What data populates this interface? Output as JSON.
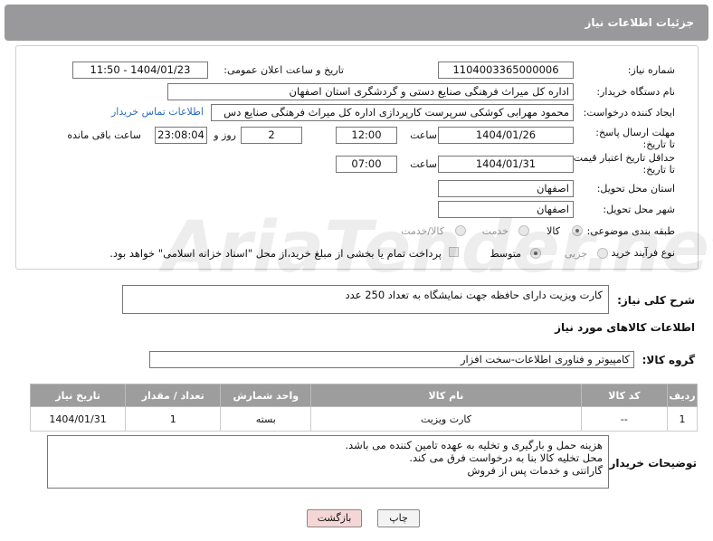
{
  "header": {
    "title": "جزئیات اطلاعات نیاز"
  },
  "fields": {
    "need_number_label": "شماره نیاز:",
    "need_number": "1104003365000006",
    "announce_label": "تاریخ و ساعت اعلان عمومی:",
    "announce_value": "1404/01/23 - 11:50",
    "buyer_org_label": "نام دستگاه خریدار:",
    "buyer_org": "اداره کل میراث فرهنگی  صنایع دستی و گردشگری استان اصفهان",
    "creator_label": "ایجاد کننده درخواست:",
    "creator": "محمود مهرابی کوشکی سرپرست کارپردازی اداره کل میراث فرهنگی  صنایع دس",
    "contact_link": "اطلاعات تماس خریدار",
    "reply_deadline_label": "مهلت ارسال پاسخ: تا تاریخ:",
    "reply_date": "1404/01/26",
    "time_label": "ساعت",
    "reply_time": "12:00",
    "days_value": "2",
    "days_label": "روز و",
    "remaining_time": "23:08:04",
    "remaining_label": "ساعت باقی مانده",
    "price_deadline_label": "حداقل تاریخ اعتبار قیمت: تا تاریخ:",
    "price_date": "1404/01/31",
    "price_time": "07:00",
    "province_label": "استان محل تحویل:",
    "province": "اصفهان",
    "city_label": "شهر محل تحویل:",
    "city": "اصفهان",
    "category_label": "طبقه بندی موضوعی:",
    "category_options": [
      "کالا",
      "خدمت",
      "کالا/خدمت"
    ],
    "process_label": "نوع فرآیند خرید :",
    "process_options": [
      "جزیی",
      "متوسط"
    ],
    "payment_note": "پرداخت تمام یا بخشی از مبلغ خرید،از محل \"اسناد خزانه اسلامی\" خواهد بود."
  },
  "description": {
    "label": "شرح کلی نیاز:",
    "text": "کارت ویزیت دارای حافظه جهت نمایشگاه به تعداد 250 عدد"
  },
  "goods": {
    "section_title": "اطلاعات کالاهای مورد نیاز",
    "group_label": "گروه کالا:",
    "group_value": "کامپیوتر و فناوری اطلاعات-سخت افزار",
    "columns": [
      "ردیف",
      "کد کالا",
      "نام کالا",
      "واحد شمارش",
      "تعداد / مقدار",
      "تاریخ نیاز"
    ],
    "rows": [
      {
        "row": "1",
        "code": "--",
        "name": "کارت ویزیت",
        "unit": "بسته",
        "qty": "1",
        "date": "1404/01/31"
      }
    ]
  },
  "buyer_notes": {
    "label": "توضیحات خریدار:",
    "text": "هزینه حمل و بارگیری و تخلیه به عهده تامین کننده می باشد.\nمحل تخلیه کالا بنا به درخواست فرق می کند.\nگارانتی و خدمات پس از فروش"
  },
  "buttons": {
    "print": "چاپ",
    "back": "بازگشت"
  },
  "watermark": "AriaTender.net",
  "colors": {
    "header_bg": "#99999b",
    "link": "#2a6ebb",
    "back_button_bg": "#f5d6d6"
  }
}
